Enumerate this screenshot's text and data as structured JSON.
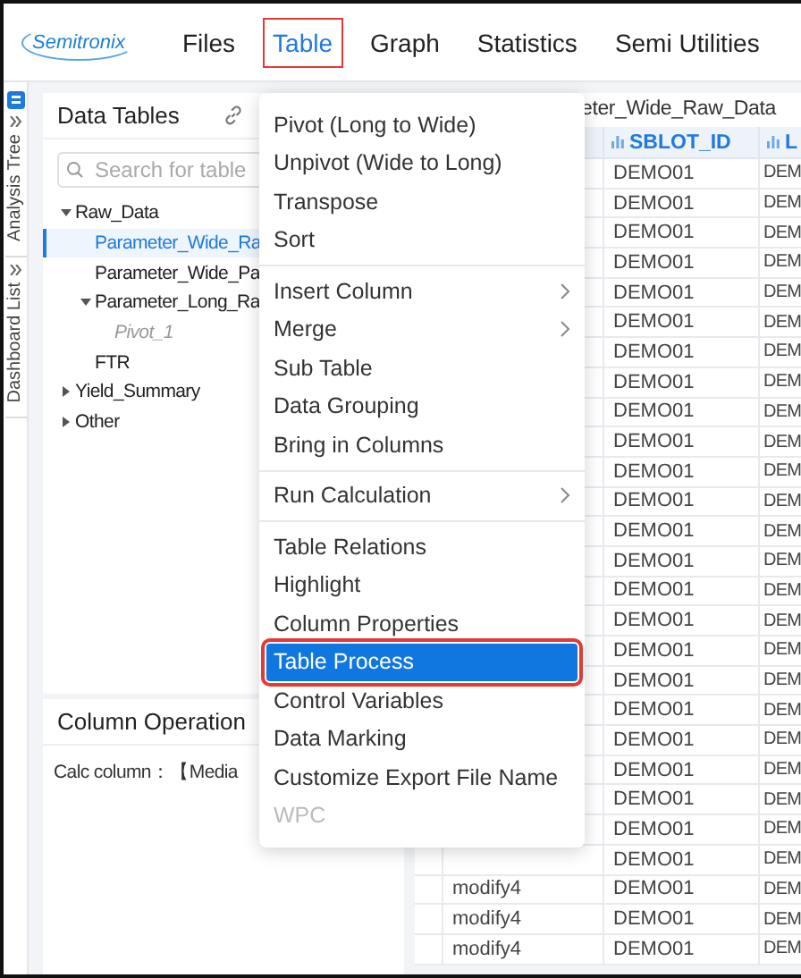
{
  "logo": "Semitronix",
  "nav": [
    {
      "label": "Files",
      "selected": false
    },
    {
      "label": "Table",
      "selected": true
    },
    {
      "label": "Graph",
      "selected": false
    },
    {
      "label": "Statistics",
      "selected": false
    },
    {
      "label": "Semi Utilities",
      "selected": false
    }
  ],
  "side_tabs": [
    "Analysis Tree",
    "Dashboard List"
  ],
  "data_tables": {
    "title": "Data Tables",
    "search": {
      "placeholder": "Search for table"
    },
    "tree": [
      {
        "label": "Raw_Data",
        "expanded": true,
        "children": [
          {
            "label": "Parameter_Wide_Ra",
            "selected": true
          },
          {
            "label": "Parameter_Wide_Pa",
            "selected": false
          },
          {
            "label": "Parameter_Long_Ra",
            "selected": false,
            "expanded": true,
            "children": [
              {
                "label": "Pivot_1",
                "selected": false,
                "kind": "derived"
              }
            ]
          },
          {
            "label": "FTR",
            "selected": false
          }
        ]
      },
      {
        "label": "Yield_Summary",
        "expanded": false
      },
      {
        "label": "Other",
        "expanded": false
      }
    ]
  },
  "column_operation": {
    "title": "Column Operation",
    "text": "Calc column：【Media"
  },
  "table": {
    "title": "eter_Wide_Raw_Data",
    "columns": [
      "SBLOT_ID",
      "L"
    ],
    "rows": [
      {
        "sblot_id": "DEMO01",
        "column_3": "DEM"
      },
      {
        "sblot_id": "DEMO01",
        "column_3": "DEM"
      },
      {
        "sblot_id": "DEMO01",
        "column_3": "DEM"
      },
      {
        "sblot_id": "DEMO01",
        "column_3": "DEM"
      },
      {
        "sblot_id": "DEMO01",
        "column_3": "DEM"
      },
      {
        "sblot_id": "DEMO01",
        "column_3": "DEM"
      },
      {
        "sblot_id": "DEMO01",
        "column_3": "DEM"
      },
      {
        "sblot_id": "DEMO01",
        "column_3": "DEM"
      },
      {
        "sblot_id": "DEMO01",
        "column_3": "DEM"
      },
      {
        "sblot_id": "DEMO01",
        "column_3": "DEM"
      },
      {
        "sblot_id": "DEMO01",
        "column_3": "DEM"
      },
      {
        "sblot_id": "DEMO01",
        "column_3": "DEM"
      },
      {
        "sblot_id": "DEMO01",
        "column_3": "DEM"
      },
      {
        "sblot_id": "DEMO01",
        "column_3": "DEM"
      },
      {
        "sblot_id": "DEMO01",
        "column_3": "DEM"
      },
      {
        "sblot_id": "DEMO01",
        "column_3": "DEM"
      },
      {
        "sblot_id": "DEMO01",
        "column_3": "DEM"
      },
      {
        "sblot_id": "DEMO01",
        "column_3": "DEM"
      },
      {
        "sblot_id": "DEMO01",
        "column_3": "DEM"
      },
      {
        "sblot_id": "DEMO01",
        "column_3": "DEM"
      },
      {
        "sblot_id": "DEMO01",
        "column_3": "DEM"
      },
      {
        "sblot_id": "DEMO01",
        "column_3": "DEM"
      },
      {
        "sblot_id": "DEMO01",
        "column_3": "DEM"
      },
      {
        "sblot_id": "DEMO01",
        "column_3": "DEM"
      },
      {
        "column_1": "modify4",
        "sblot_id": "DEMO01",
        "column_3": "DEM"
      },
      {
        "column_1": "modify4",
        "sblot_id": "DEMO01",
        "column_3": "DEM"
      },
      {
        "column_1": "modify4",
        "sblot_id": "DEMO01",
        "column_3": "DEM"
      }
    ]
  },
  "menu": {
    "groups": [
      [
        {
          "label": "Pivot (Long to Wide)",
          "submenu": false,
          "selected": false,
          "disabled": false
        },
        {
          "label": "Unpivot (Wide to Long)",
          "submenu": false,
          "selected": false,
          "disabled": false
        },
        {
          "label": "Transpose",
          "submenu": false,
          "selected": false,
          "disabled": false
        },
        {
          "label": "Sort",
          "submenu": false,
          "selected": false,
          "disabled": false
        }
      ],
      [
        {
          "label": "Insert Column",
          "submenu": true,
          "selected": false,
          "disabled": false
        },
        {
          "label": "Merge",
          "submenu": true,
          "selected": false,
          "disabled": false
        },
        {
          "label": "Sub Table",
          "submenu": false,
          "selected": false,
          "disabled": false
        },
        {
          "label": "Data Grouping",
          "submenu": false,
          "selected": false,
          "disabled": false
        },
        {
          "label": "Bring in Columns",
          "submenu": false,
          "selected": false,
          "disabled": false
        }
      ],
      [
        {
          "label": "Run Calculation",
          "submenu": true,
          "selected": false,
          "disabled": false
        }
      ],
      [
        {
          "label": "Table Relations",
          "submenu": false,
          "selected": false,
          "disabled": false
        },
        {
          "label": "Highlight",
          "submenu": false,
          "selected": false,
          "disabled": false
        },
        {
          "label": "Column Properties",
          "submenu": false,
          "selected": false,
          "disabled": false
        },
        {
          "label": "Table Process",
          "submenu": false,
          "selected": true,
          "disabled": false
        },
        {
          "label": "Control Variables",
          "submenu": false,
          "selected": false,
          "disabled": false
        },
        {
          "label": "Data Marking",
          "submenu": false,
          "selected": false,
          "disabled": false
        },
        {
          "label": "Customize Export File Name",
          "submenu": false,
          "selected": false,
          "disabled": false
        },
        {
          "label": "WPC",
          "submenu": false,
          "selected": false,
          "disabled": true
        }
      ]
    ]
  }
}
